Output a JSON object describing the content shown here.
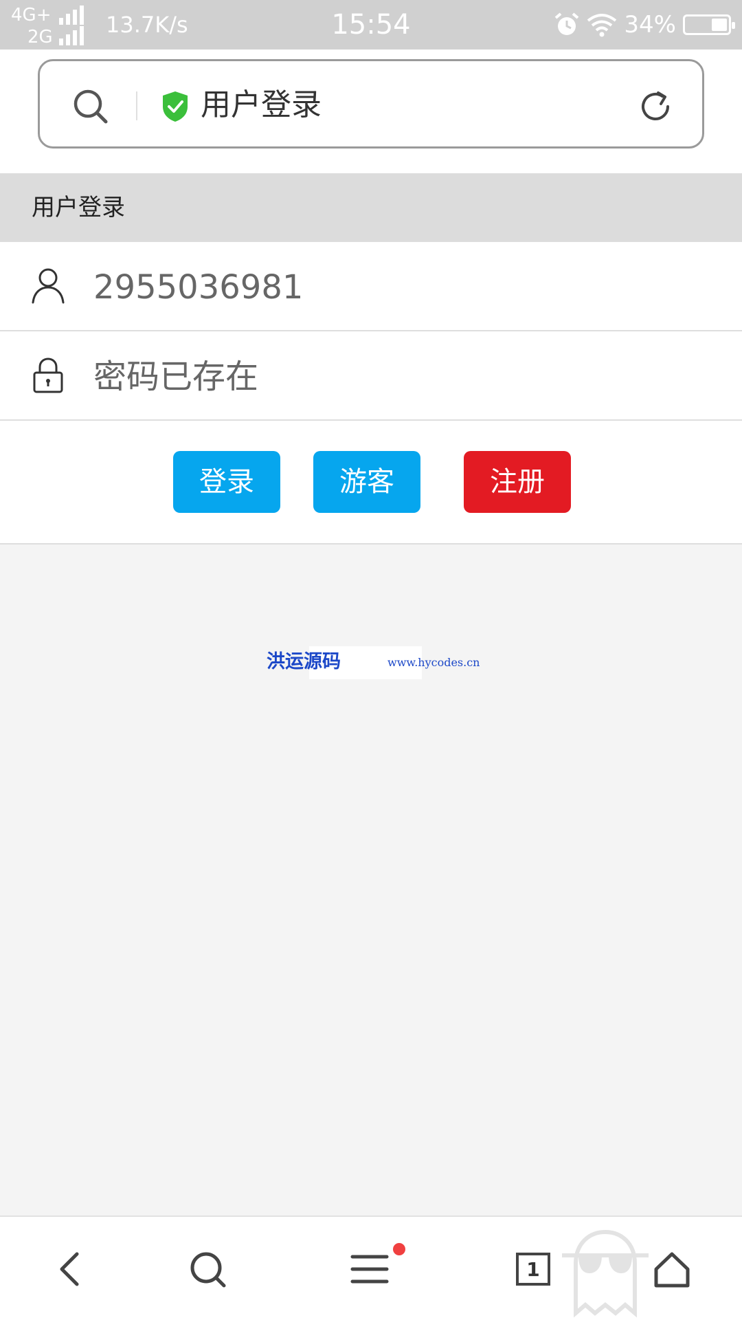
{
  "status_bar": {
    "network_1": "4G+",
    "network_2": "2G",
    "speed": "13.7K/s",
    "time": "15:54",
    "battery_percent": "34%",
    "battery_level": 0.34,
    "icons": [
      "signal-icon",
      "alarm-icon",
      "wifi-icon",
      "battery-icon"
    ]
  },
  "address_bar": {
    "title": "用户登录",
    "icons": [
      "search-icon",
      "secure-shield-icon",
      "refresh-icon"
    ],
    "shield_color": "#3bbf3b"
  },
  "section_header": {
    "title": "用户登录"
  },
  "form": {
    "username_value": "2955036981",
    "password_placeholder": "密码已存在",
    "icons": [
      "user-icon",
      "lock-icon"
    ]
  },
  "buttons": {
    "login_label": "登录",
    "guest_label": "游客",
    "register_label": "注册",
    "primary_color": "#06a6ee",
    "danger_color": "#e31b23"
  },
  "watermark": {
    "brand": "洪运源码",
    "url": "www.hycodes.cn"
  },
  "bottom_nav": {
    "tab_count": "1",
    "icons": [
      "back-icon",
      "search-icon",
      "menu-icon",
      "tabs-icon",
      "incognito-ghost-icon",
      "home-icon"
    ]
  }
}
